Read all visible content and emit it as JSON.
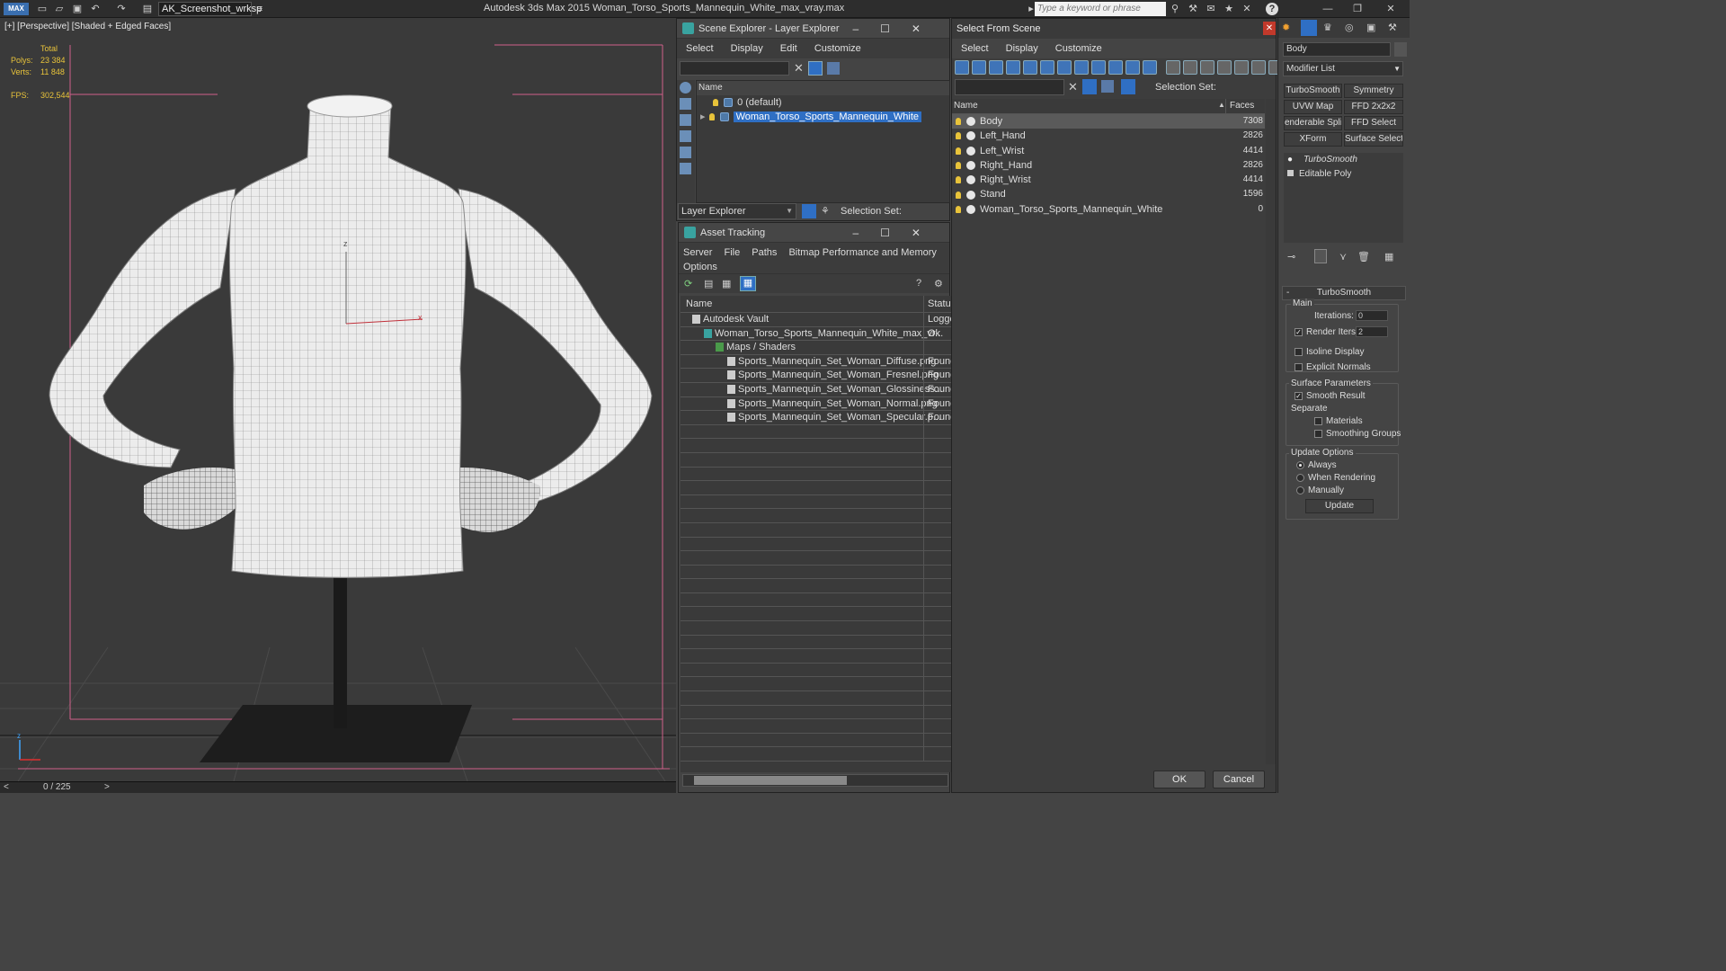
{
  "titlebar": {
    "workspace": "AK_Screenshot_wrksp",
    "app_title": "Autodesk 3ds Max  2015     Woman_Torso_Sports_Mannequin_White_max_vray.max",
    "search_placeholder": "Type a keyword or phrase"
  },
  "viewport": {
    "label": "[+] [Perspective] [Shaded + Edged Faces]",
    "stats": {
      "total_label": "Total",
      "polys_label": "Polys:",
      "polys_value": "23 384",
      "verts_label": "Verts:",
      "verts_value": "11 848",
      "fps_label": "FPS:",
      "fps_value": "302,544"
    },
    "frame_counter": "0 / 225"
  },
  "scene_explorer": {
    "title": "Scene Explorer - Layer Explorer",
    "menu": [
      "Select",
      "Display",
      "Edit",
      "Customize"
    ],
    "column_name": "Name",
    "rows": [
      {
        "label": "0 (default)",
        "selected": false
      },
      {
        "label": "Woman_Torso_Sports_Mannequin_White",
        "selected": true
      }
    ],
    "explorer_dropdown": "Layer Explorer",
    "selection_set_label": "Selection Set:"
  },
  "asset_tracking": {
    "title": "Asset Tracking",
    "menu": [
      "Server",
      "File",
      "Paths",
      "Bitmap Performance and Memory",
      "Options"
    ],
    "columns": [
      "Name",
      "Status"
    ],
    "rows": [
      {
        "name": "Autodesk Vault",
        "status": "Logge",
        "indent": 1
      },
      {
        "name": "Woman_Torso_Sports_Mannequin_White_max_vr...",
        "status": "Ok",
        "indent": 2
      },
      {
        "name": "Maps / Shaders",
        "status": "",
        "indent": 3
      },
      {
        "name": "Sports_Mannequin_Set_Woman_Diffuse.png",
        "status": "Founc",
        "indent": 4
      },
      {
        "name": "Sports_Mannequin_Set_Woman_Fresnel.png",
        "status": "Founc",
        "indent": 4
      },
      {
        "name": "Sports_Mannequin_Set_Woman_Glossiness...",
        "status": "Founc",
        "indent": 4
      },
      {
        "name": "Sports_Mannequin_Set_Woman_Normal.png",
        "status": "Founc",
        "indent": 4
      },
      {
        "name": "Sports_Mannequin_Set_Woman_Specular.p...",
        "status": "Founc",
        "indent": 4
      }
    ]
  },
  "select_from_scene": {
    "title": "Select From Scene",
    "menu": [
      "Select",
      "Display",
      "Customize"
    ],
    "selection_set_label": "Selection Set:",
    "columns": [
      "Name",
      "Faces"
    ],
    "rows": [
      {
        "name": "Body",
        "faces": "7308",
        "selected": true
      },
      {
        "name": "Left_Hand",
        "faces": "2826",
        "selected": false
      },
      {
        "name": "Left_Wrist",
        "faces": "4414",
        "selected": false
      },
      {
        "name": "Right_Hand",
        "faces": "2826",
        "selected": false
      },
      {
        "name": "Right_Wrist",
        "faces": "4414",
        "selected": false
      },
      {
        "name": "Stand",
        "faces": "1596",
        "selected": false
      },
      {
        "name": "Woman_Torso_Sports_Mannequin_White",
        "faces": "0",
        "selected": false
      }
    ],
    "ok_label": "OK",
    "cancel_label": "Cancel"
  },
  "command_panel": {
    "object_name": "Body",
    "modifier_list": "Modifier List",
    "modifier_buttons": [
      "TurboSmooth",
      "Symmetry",
      "UVW Map",
      "FFD 2x2x2",
      "enderable Splin",
      "FFD Select",
      "XForm",
      "Surface Select"
    ],
    "stack": [
      "TurboSmooth",
      "Editable Poly"
    ],
    "rollout_title": "TurboSmooth",
    "main_label": "Main",
    "iterations_label": "Iterations:",
    "iterations_value": "0",
    "render_iters_label": "Render Iters:",
    "render_iters_value": "2",
    "isoline_label": "Isoline Display",
    "explicit_normals_label": "Explicit Normals",
    "surface_params_label": "Surface Parameters",
    "smooth_result_label": "Smooth Result",
    "separate_label": "Separate",
    "materials_label": "Materials",
    "smoothing_groups_label": "Smoothing Groups",
    "update_options_label": "Update Options",
    "always_label": "Always",
    "when_rendering_label": "When Rendering",
    "manually_label": "Manually",
    "update_button": "Update"
  },
  "colors": {
    "selection_blue": "#2f6fc4",
    "stat_yellow": "#e8c33a",
    "close_red": "#c2392b"
  }
}
